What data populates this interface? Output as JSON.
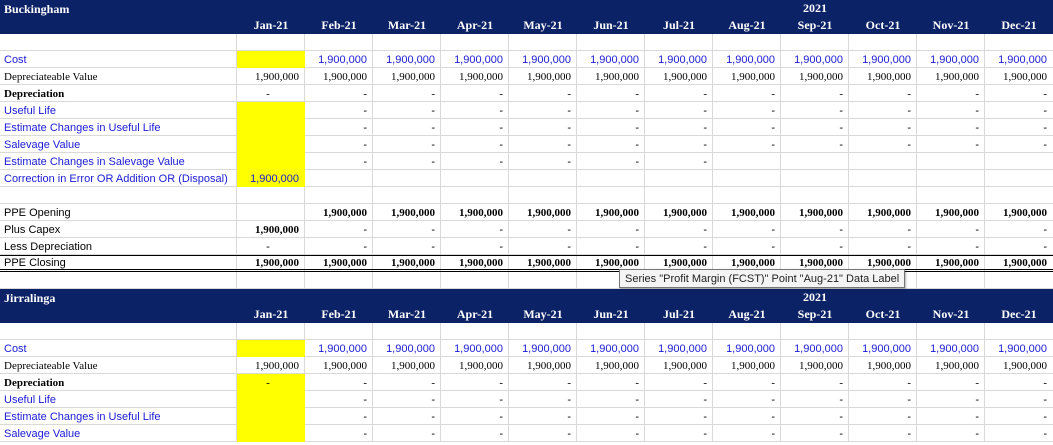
{
  "months": [
    "Jan-21",
    "Feb-21",
    "Mar-21",
    "Apr-21",
    "May-21",
    "Jun-21",
    "Jul-21",
    "Aug-21",
    "Sep-21",
    "Oct-21",
    "Nov-21",
    "Dec-21"
  ],
  "year": "2021",
  "colors": {
    "header_bg": "#0c2266",
    "input_fill": "#ffff00",
    "input_text": "#1b1bd6"
  },
  "tooltip": "Series \"Profit Margin (FCST)\" Point \"Aug-21\" Data Label",
  "sections": [
    {
      "title": "Buckingham",
      "rows": [
        {
          "type": "blank"
        },
        {
          "label": "Cost",
          "style": "blue",
          "first": "",
          "vals": [
            "1,900,000",
            "1,900,000",
            "1,900,000",
            "1,900,000",
            "1,900,000",
            "1,900,000",
            "1,900,000",
            "1,900,000",
            "1,900,000",
            "1,900,000",
            "1,900,000"
          ],
          "yellow": true
        },
        {
          "label": "Depreciateable Value",
          "style": "serif",
          "first": "1,900,000",
          "vals": [
            "1,900,000",
            "1,900,000",
            "1,900,000",
            "1,900,000",
            "1,900,000",
            "1,900,000",
            "1,900,000",
            "1,900,000",
            "1,900,000",
            "1,900,000",
            "1,900,000"
          ]
        },
        {
          "label": "Depreciation",
          "style": "serifbold",
          "first": "-",
          "vals": [
            "-",
            "-",
            "-",
            "-",
            "-",
            "-",
            "-",
            "-",
            "-",
            "-",
            "-"
          ]
        },
        {
          "label": "Useful Life",
          "style": "blue",
          "first": "",
          "vals": [
            "-",
            "-",
            "-",
            "-",
            "-",
            "-",
            "-",
            "-",
            "-",
            "-",
            "-"
          ],
          "yellow": true
        },
        {
          "label": "Estimate Changes in Useful Life",
          "style": "blue",
          "first": "",
          "vals": [
            "-",
            "-",
            "-",
            "-",
            "-",
            "-",
            "-",
            "-",
            "-",
            "-",
            "-"
          ],
          "yellow": true
        },
        {
          "label": "Salevage Value",
          "style": "blue",
          "first": "",
          "vals": [
            "-",
            "-",
            "-",
            "-",
            "-",
            "-",
            "-",
            "-",
            "-",
            "-",
            "-"
          ],
          "yellow": true
        },
        {
          "label": "Estimate Changes in Salevage Value",
          "style": "blue",
          "first": "",
          "vals": [
            "-",
            "-",
            "-",
            "-",
            "-",
            "-",
            "",
            "",
            "",
            "",
            ""
          ],
          "yellow": true
        },
        {
          "label": "Correction in Error OR Addition OR (Disposal)",
          "style": "blue",
          "first": "1,900,000",
          "vals": [
            "",
            "",
            "",
            "",
            "",
            "",
            "",
            "",
            "",
            "",
            ""
          ],
          "yellow": true
        },
        {
          "type": "blank"
        },
        {
          "label": "PPE Opening",
          "style": "plain",
          "first": "",
          "vals": [
            "1,900,000",
            "1,900,000",
            "1,900,000",
            "1,900,000",
            "1,900,000",
            "1,900,000",
            "1,900,000",
            "1,900,000",
            "1,900,000",
            "1,900,000",
            "1,900,000"
          ],
          "bold": true
        },
        {
          "label": "Plus Capex",
          "style": "plain",
          "first": "1,900,000",
          "vals": [
            "-",
            "-",
            "-",
            "-",
            "-",
            "-",
            "-",
            "-",
            "-",
            "-",
            "-"
          ],
          "firstbold": true
        },
        {
          "label": "Less Depreciation",
          "style": "plain",
          "first": "-",
          "vals": [
            "-",
            "-",
            "-",
            "-",
            "-",
            "-",
            "-",
            "-",
            "-",
            "-",
            "-"
          ]
        },
        {
          "label": "PPE Closing",
          "style": "plain",
          "first": "1,900,000",
          "vals": [
            "1,900,000",
            "1,900,000",
            "1,900,000",
            "1,900,000",
            "1,900,000",
            "1,900,000",
            "1,900,000",
            "1,900,000",
            "1,900,000",
            "1,900,000",
            "1,900,000"
          ],
          "bold": true,
          "closing": true
        },
        {
          "type": "blank"
        }
      ]
    },
    {
      "title": "Jirralinga",
      "rows": [
        {
          "type": "blank"
        },
        {
          "label": "Cost",
          "style": "blue",
          "first": "",
          "vals": [
            "1,900,000",
            "1,900,000",
            "1,900,000",
            "1,900,000",
            "1,900,000",
            "1,900,000",
            "1,900,000",
            "1,900,000",
            "1,900,000",
            "1,900,000",
            "1,900,000"
          ],
          "yellow": true
        },
        {
          "label": "Depreciateable Value",
          "style": "serif",
          "first": "1,900,000",
          "vals": [
            "1,900,000",
            "1,900,000",
            "1,900,000",
            "1,900,000",
            "1,900,000",
            "1,900,000",
            "1,900,000",
            "1,900,000",
            "1,900,000",
            "1,900,000",
            "1,900,000"
          ]
        },
        {
          "label": "Depreciation",
          "style": "serifbold",
          "first": "-",
          "vals": [
            "-",
            "-",
            "-",
            "-",
            "-",
            "-",
            "-",
            "-",
            "-",
            "-",
            "-"
          ],
          "yellow": true
        },
        {
          "label": "Useful Life",
          "style": "blue",
          "first": "",
          "vals": [
            "-",
            "-",
            "-",
            "-",
            "-",
            "-",
            "-",
            "-",
            "-",
            "-",
            "-"
          ],
          "yellow": true
        },
        {
          "label": "Estimate Changes in Useful Life",
          "style": "blue",
          "first": "",
          "vals": [
            "-",
            "-",
            "-",
            "-",
            "-",
            "-",
            "-",
            "-",
            "-",
            "-",
            "-"
          ],
          "yellow": true
        },
        {
          "label": "Salevage Value",
          "style": "blue",
          "first": "",
          "vals": [
            "-",
            "-",
            "-",
            "-",
            "-",
            "-",
            "-",
            "-",
            "-",
            "-",
            "-"
          ],
          "yellow": true
        }
      ]
    }
  ]
}
